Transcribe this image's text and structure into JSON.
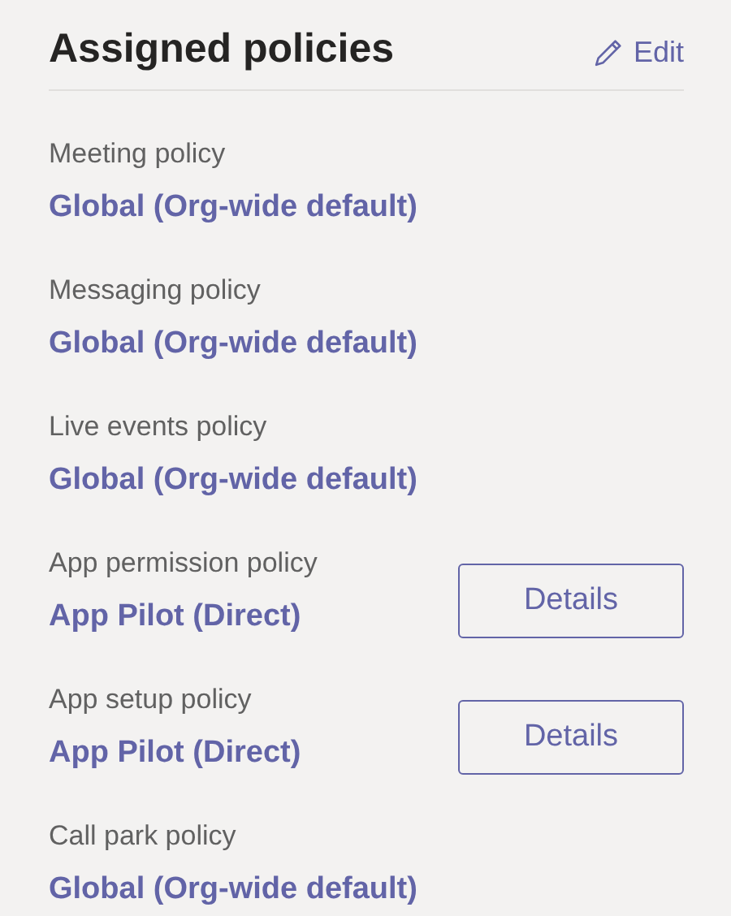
{
  "header": {
    "title": "Assigned policies",
    "edit_label": "Edit"
  },
  "policies": [
    {
      "label": "Meeting policy",
      "value": "Global (Org-wide default)"
    },
    {
      "label": "Messaging policy",
      "value": "Global (Org-wide default)"
    },
    {
      "label": "Live events policy",
      "value": "Global (Org-wide default)"
    },
    {
      "label": "App permission policy",
      "value": "App Pilot (Direct)",
      "button": "Details"
    },
    {
      "label": "App setup policy",
      "value": "App Pilot (Direct)",
      "button": "Details"
    },
    {
      "label": "Call park policy",
      "value": "Global (Org-wide default)"
    }
  ]
}
